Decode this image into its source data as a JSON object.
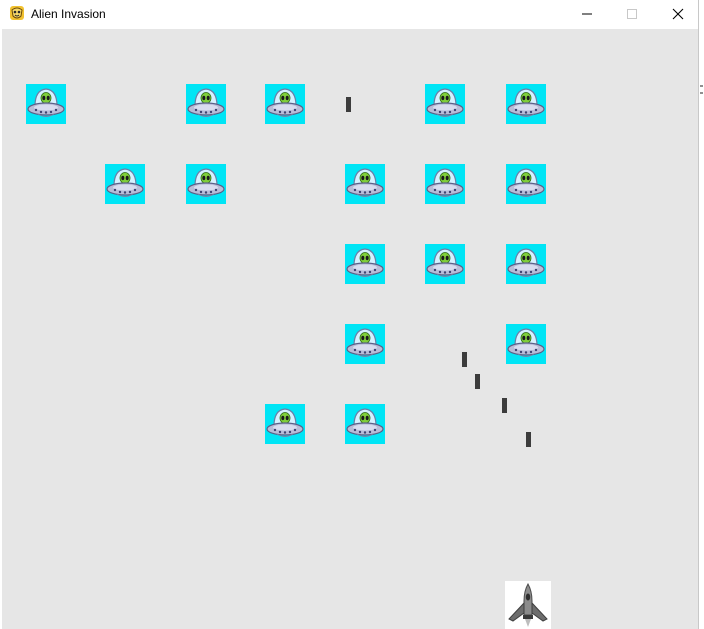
{
  "window": {
    "title": "Alien Invasion",
    "minimize_icon": "minimize-icon",
    "maximize_icon": "maximize-icon",
    "close_icon": "close-icon"
  },
  "colors": {
    "background": "#e6e6e6",
    "alien_bg": "#00e5f5",
    "bullet": "#3c3c3c"
  },
  "game": {
    "alien_icon": "alien-ufo-icon",
    "ship_icon": "rocket-ship-icon"
  }
}
